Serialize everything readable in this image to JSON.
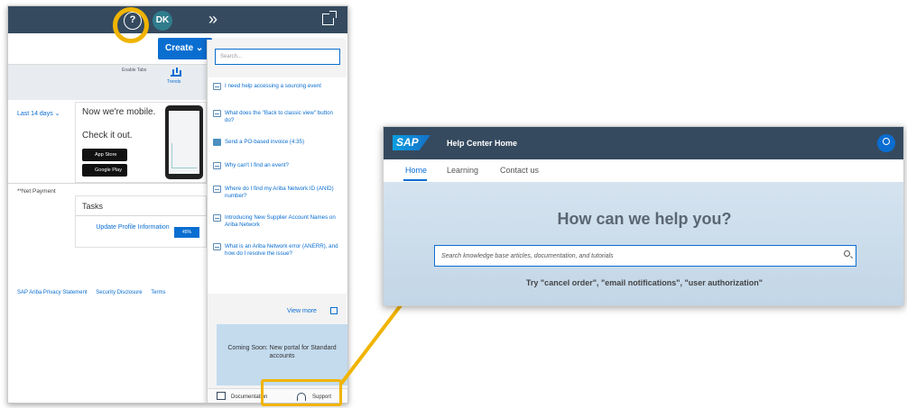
{
  "left_panel": {
    "help_icon": "?",
    "avatar": "DK",
    "expand_icon": "»",
    "create_button": "Create ⌄",
    "enable_tabs": "Enable Tabs",
    "trends_label": "Trends",
    "date_filter": "Last 14 days ⌄",
    "mobile_title": "Now we're mobile.",
    "mobile_cta": "Check it out.",
    "app_store": "App Store",
    "google_play": "Google Play",
    "net_payment": "**Net Payment",
    "tasks_title": "Tasks",
    "task_item": "Update Profile Information",
    "task_percent": "45%",
    "footer_links": [
      "SAP Ariba Privacy Statement",
      "Security Disclosure",
      "Terms"
    ]
  },
  "help_flyout": {
    "search_placeholder": "Search...",
    "articles": [
      "I need help accessing a sourcing event",
      "What does the \"Back to classic view\" button do?",
      "Send a PO-based invoice (4:35)",
      "Why can't I find an event?",
      "Where do I find my Ariba Network ID (ANID) number?",
      "Introducing New Supplier Account Names on Ariba Network",
      "What is an Ariba Network error (ANERR), and how do I resolve the issue?"
    ],
    "view_more": "View more",
    "coming_soon": "Coming Soon: New portal for Standard accounts",
    "documentation": "Documentation",
    "support": "Support"
  },
  "help_center": {
    "logo": "SAP",
    "title": "Help Center Home",
    "tabs": [
      "Home",
      "Learning",
      "Contact us"
    ],
    "headline": "How can we help you?",
    "search_placeholder": "Search knowledge base articles, documentation, and tutorials",
    "try_text": "Try  \"cancel order\", \"email notifications\", \"user authorization\""
  },
  "colors": {
    "shell_bar": "#354a5f",
    "accent": "#0a6ed1",
    "highlight": "#f0b400"
  }
}
